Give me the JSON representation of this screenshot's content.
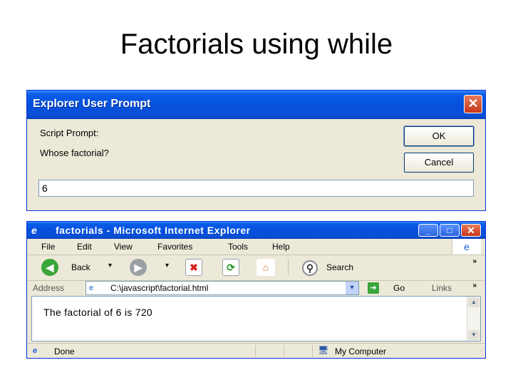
{
  "slide": {
    "title": "Factorials using while"
  },
  "dialog": {
    "title": "Explorer User Prompt",
    "close_glyph": "✕",
    "prompt_label": "Script Prompt:",
    "question": "Whose factorial?",
    "ok_label": "OK",
    "cancel_label": "Cancel",
    "input_value": "6"
  },
  "ie": {
    "title": "factorials - Microsoft Internet Explorer",
    "icon_glyph": "e",
    "min_glyph": "_",
    "max_glyph": "□",
    "close_glyph": "✕",
    "menu": [
      "File",
      "Edit",
      "View",
      "Favorites",
      "Tools",
      "Help"
    ],
    "toolbar": {
      "back_label": "Back",
      "search_label": "Search",
      "back_glyph": "◀",
      "forward_glyph": "▶",
      "stop_glyph": "✖",
      "refresh_glyph": "⟳",
      "home_glyph": "⌂",
      "search_glyph": "⚲",
      "dropdown_glyph": "▾",
      "chevron": "»"
    },
    "address": {
      "label": "Address",
      "url": "C:\\javascript\\factorial.html",
      "page_glyph": "e",
      "dropdown_glyph": "▾",
      "go_glyph": "➔",
      "go_label": "Go",
      "links_label": "Links",
      "chevron": "»"
    },
    "content": {
      "text": "The factorial of 6 is 720"
    },
    "scroll": {
      "up_glyph": "▲",
      "down_glyph": "▼"
    },
    "status": {
      "text": "Done",
      "zone": "My Computer",
      "status_glyph": "e",
      "zone_glyph": "🖥",
      "grip_glyph": "⋰"
    },
    "colors": {
      "titlebar": "#0550dc",
      "chrome": "#ece9d8",
      "close": "#c5371b"
    }
  }
}
